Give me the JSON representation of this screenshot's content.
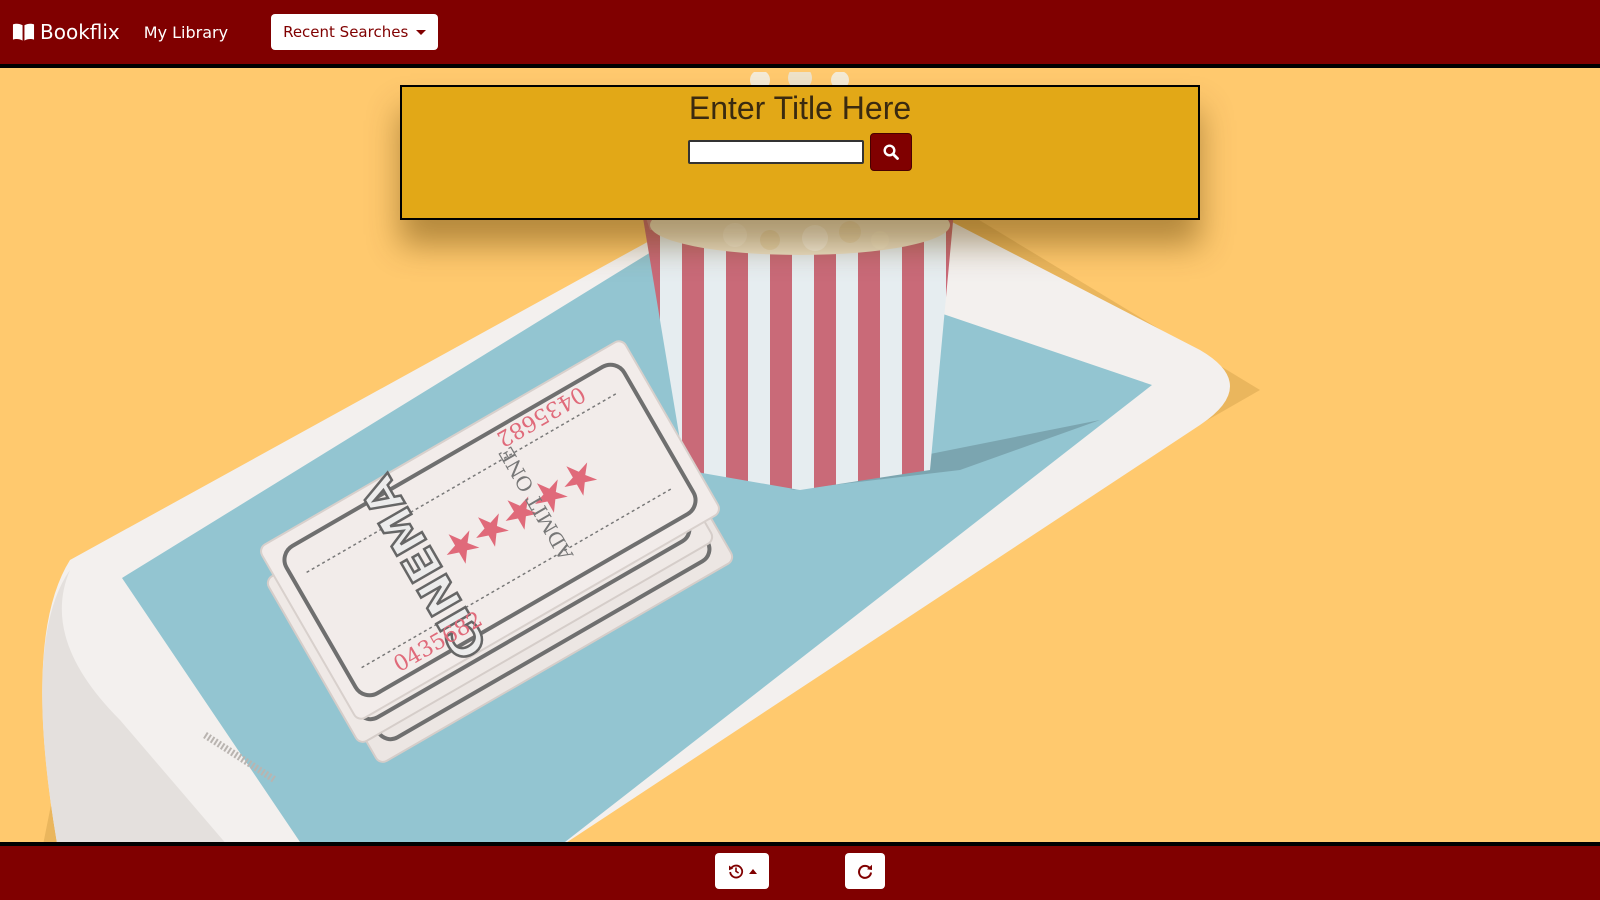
{
  "navbar": {
    "brand": "Bookflix",
    "brand_icon": "open-book-icon",
    "my_library": "My Library",
    "recent_searches": "Recent Searches"
  },
  "search": {
    "title": "Enter Title Here",
    "value": "",
    "placeholder": "",
    "button_icon": "search-icon"
  },
  "scene": {
    "ticket_title": "CINEMA",
    "ticket_text": "ADMIT ONE",
    "ticket_number": "0435682"
  },
  "footer": {
    "history_icon": "history-icon",
    "redo_icon": "redo-icon"
  },
  "colors": {
    "brand": "#800000",
    "panel": "#e2a817",
    "background": "#ffc96e"
  }
}
